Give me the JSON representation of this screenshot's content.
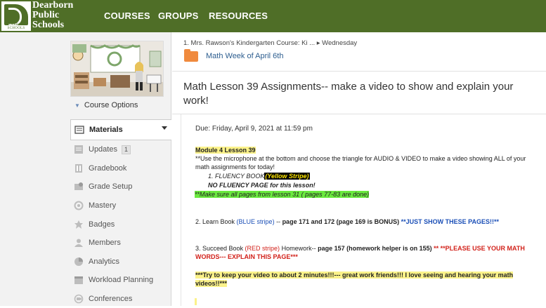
{
  "brand": {
    "line1": "Dearborn",
    "line2": "Public",
    "line3": "Schools",
    "small": "DEARBORN SCHOOLS",
    "color": "#4f6e27"
  },
  "nav": {
    "courses": "COURSES",
    "groups": "GROUPS",
    "resources": "RESOURCES"
  },
  "sidebar": {
    "course_options": "Course Options",
    "items": [
      {
        "label": "Materials",
        "icon": "materials-icon"
      },
      {
        "label": "Updates",
        "icon": "updates-icon",
        "badge": "1"
      },
      {
        "label": "Gradebook",
        "icon": "gradebook-icon"
      },
      {
        "label": "Grade Setup",
        "icon": "grade-setup-icon"
      },
      {
        "label": "Mastery",
        "icon": "mastery-icon"
      },
      {
        "label": "Badges",
        "icon": "badges-icon"
      },
      {
        "label": "Members",
        "icon": "members-icon"
      },
      {
        "label": "Analytics",
        "icon": "analytics-icon"
      },
      {
        "label": "Workload Planning",
        "icon": "workload-planning-icon"
      },
      {
        "label": "Conferences",
        "icon": "conferences-icon"
      }
    ]
  },
  "main": {
    "breadcrumb": "1. Mrs. Rawson's Kindergarten Course: Ki ... ▸ Wednesday",
    "folder_title": "Math Week of April 6th",
    "title": "Math Lesson 39 Assignments-- make a video to show and explain your work!",
    "due": "Due: Friday, April 9, 2021 at 11:59 pm",
    "module": "Module 4  Lesson 39",
    "instructions": "**Use the microphone at the bottom and choose the triangle for AUDIO & VIDEO to make a video showing ALL of your math assignments for today!",
    "fluency_label": "1. FLUENCY BOOK",
    "fluency_stripe": "(Yellow Stripe)",
    "no_fluency": "NO FLUENCY PAGE for this lesson!",
    "make_sure": "**Make sure all pages from lesson 31 ( pages 77-83 are done)",
    "learn_a": "2.  Learn Book ",
    "learn_stripe": "(BLUE stripe)",
    "learn_b": " -- ",
    "learn_pages": "page 171 and 172 (page 169 is BONUS)",
    "learn_note": "  **JUST SHOW THESE PAGES!!**",
    "succeed_a": "3. Succeed Book ",
    "succeed_stripe": "(RED stripe)",
    "succeed_b": " Homework-- ",
    "succeed_pages": "page 157  (homework helper is on 155)",
    "succeed_note": " ** **PLEASE USE YOUR MATH WORDS--- EXPLAIN THIS PAGE***",
    "closing": "***Try to keep your video to about 2 minutes!!!--- great work friends!!!  I love seeing and hearing your math videos!!***"
  },
  "colors": {
    "accent": "#4f6e27",
    "folder": "#f08a3e",
    "link": "#2c5d8f",
    "highlight_yellow": "#fbf28a",
    "highlight_green": "#6bea3f"
  }
}
